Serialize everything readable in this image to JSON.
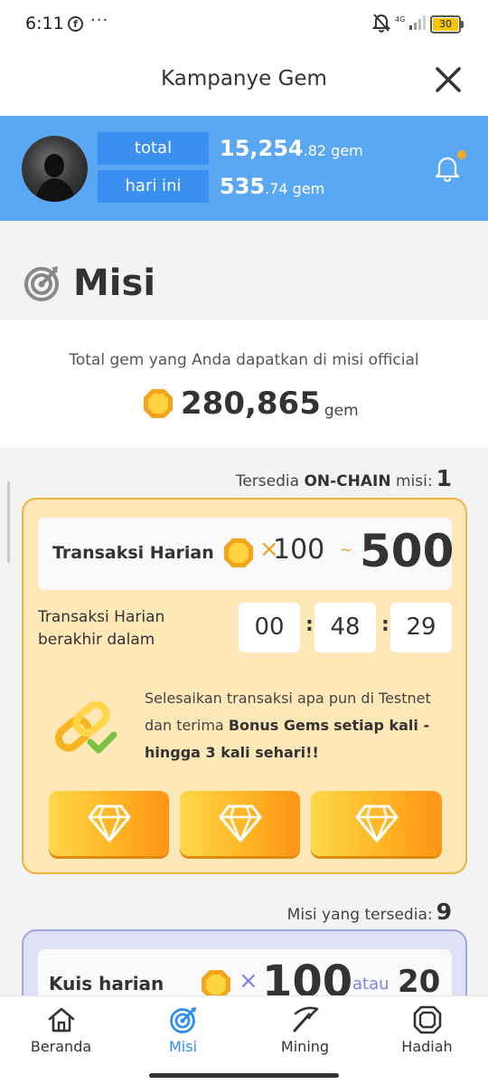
{
  "statusbar": {
    "time": "6:11",
    "fb_icon": "f",
    "dots": "···",
    "network": "4G",
    "battery": "30"
  },
  "header": {
    "title": "Kampanye Gem"
  },
  "profile": {
    "total_label": "total",
    "total_value_int": "15,254",
    "total_value_dec": ".82",
    "total_unit": "gem",
    "today_label": "hari ini",
    "today_value_int": "535",
    "today_value_dec": ".74",
    "today_unit": "gem"
  },
  "misi": {
    "title": "Misi",
    "total_desc": "Total gem yang Anda dapatkan di misi official",
    "total_gems": "280,865",
    "total_unit": "gem"
  },
  "onchain": {
    "avail_prefix": "Tersedia ",
    "avail_bold": "ON-CHAIN",
    "avail_suffix": " misi:",
    "avail_count": "1",
    "task_title": "Transaksi Harian",
    "mult": "×",
    "min": "100",
    "tilde": "~",
    "max": "500",
    "ends_line1": "Transaksi Harian",
    "ends_line2": "berakhir dalam",
    "hours": "00",
    "minutes": "48",
    "seconds": "29",
    "colon": ":",
    "bonus_part1": "Selesaikan transaksi apa pun di Testnet dan terima ",
    "bonus_bold1": "Bonus Gems",
    "bonus_bold2": "setiap kali - hingga 3 kali sehari!!"
  },
  "available": {
    "label": "Misi yang tersedia:",
    "count": "9"
  },
  "quiz": {
    "title": "Kuis harian",
    "mult": "×",
    "value": "100",
    "or": "atau",
    "value2": "20"
  },
  "nav": [
    {
      "label": "Beranda",
      "icon": "home-icon"
    },
    {
      "label": "Misi",
      "icon": "target-icon"
    },
    {
      "label": "Mining",
      "icon": "pickaxe-icon"
    },
    {
      "label": "Hadiah",
      "icon": "gem-icon"
    }
  ],
  "colors": {
    "banner": "#5aa8f3",
    "label_bg": "#3b8ff0",
    "accent_orange": "#f0a020",
    "card_onchain_bg": "#ffe8b8",
    "card_quiz_bg": "#dfe1f7",
    "nav_active": "#2d8ff0"
  }
}
